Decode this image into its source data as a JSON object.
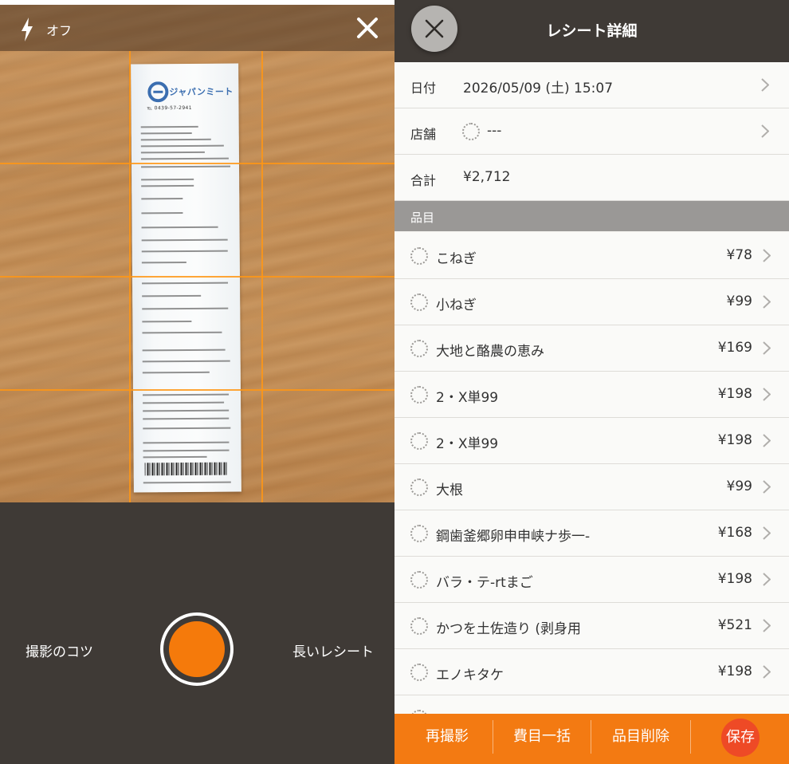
{
  "camera": {
    "flash_label": "オフ",
    "tips_label": "撮影のコツ",
    "long_receipt_label": "長いレシート",
    "receipt_preview": {
      "store_logo_text": "ジャパンミート",
      "phone": "℡ 0439-57-2941"
    }
  },
  "detail": {
    "title": "レシート詳細",
    "date": {
      "label": "日付",
      "value": "2026/05/09 (土)  15:07"
    },
    "store": {
      "label": "店舗",
      "value": "---"
    },
    "total": {
      "label": "合計",
      "value": "¥2,712"
    },
    "items_header": "品目",
    "items": [
      {
        "name": "こねぎ",
        "price": "¥78"
      },
      {
        "name": "小ねぎ",
        "price": "¥99"
      },
      {
        "name": "大地と酪農の恵み",
        "price": "¥169"
      },
      {
        "name": "2・X単99",
        "price": "¥198"
      },
      {
        "name": "2・X単99",
        "price": "¥198"
      },
      {
        "name": "大根",
        "price": "¥99"
      },
      {
        "name": "鋼歯釜郷卵申申峡ナ歩一-",
        "price": "¥168"
      },
      {
        "name": "バラ・テ-rtまご",
        "price": "¥198"
      },
      {
        "name": "かつを土佐造り (剥身用",
        "price": "¥521"
      },
      {
        "name": "エノキタケ",
        "price": "¥198"
      }
    ],
    "actions": {
      "retake": "再撮影",
      "bulk_category": "費目一括",
      "delete_item": "品目削除",
      "save": "保存"
    }
  },
  "colors": {
    "accent": "#f37a12",
    "save": "#ee4a26",
    "dark_bar": "#3f3a36"
  }
}
